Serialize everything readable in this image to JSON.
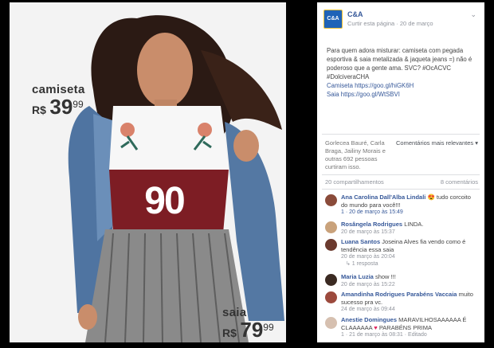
{
  "ad": {
    "shirt_label": "camiseta",
    "shirt_currency": "R$",
    "shirt_int": "39",
    "shirt_cents": "99",
    "skirt_label": "saia",
    "skirt_currency": "R$",
    "skirt_int": "79",
    "skirt_cents": "99",
    "shirt_number": "90"
  },
  "post": {
    "page_name": "C&A",
    "logo_text": "C&A",
    "meta": "Curtir esta página · 20 de março",
    "text": "Para quem adora misturar: camiseta com pegada esportiva & saia metalizada & jaqueta jeans =) não é poderoso que a gente ama. SVC? #OcACVC #DolciveraCHA",
    "link1": "Camiseta https://goo.gl/hiGK6H",
    "link2": "Saia https://goo.gl/WtSBVI"
  },
  "reactions": {
    "likers": "Gorlecea Bauré, Carla Braga, Jailiny Morais e outras 692 pessoas curtiram isso.",
    "relevance": "Comentários mais relevantes ▾",
    "shares": "20 compartilhamentos",
    "comments_count": "8 comentários"
  },
  "comments": [
    {
      "name": "Ana Carolina Dall'Alba Lindali",
      "text": "tudo corcoito do mundo para você!!!",
      "emoji": "😍",
      "meta": "1 · 20 de março às 15:49",
      "avatar": "#8a4b3a"
    },
    {
      "name": "Rosângela Rodrigues",
      "text": "LINDA.",
      "meta": "20 de março às 15:37",
      "avatar": "#c9a27b"
    },
    {
      "name": "Luana Santos",
      "text": "Joseina Alves fia vendo como é tendência essa saia",
      "meta": "20 de março às 20:04",
      "avatar": "#6b3a2e",
      "replies": "↳ 1 resposta"
    },
    {
      "name": "Maria Luzia",
      "text": "show !!!",
      "meta": "20 de março às 15:22",
      "avatar": "#3b2a22"
    },
    {
      "name": "Amandinha Rodrigues Parabéns Vaccaia",
      "text": "muito sucesso pra vc.",
      "meta": "24 de março às 09:44",
      "avatar": "#9c4a3d"
    },
    {
      "name": "Anestie Domingues",
      "text": "MARAVILHOSAAAAAA É CLAAAAAA",
      "text2": "PARABÉNS PRIMA",
      "meta": "1 · 21 de março às 08:31 · Editado",
      "avatar": "#d6c0b0"
    }
  ]
}
